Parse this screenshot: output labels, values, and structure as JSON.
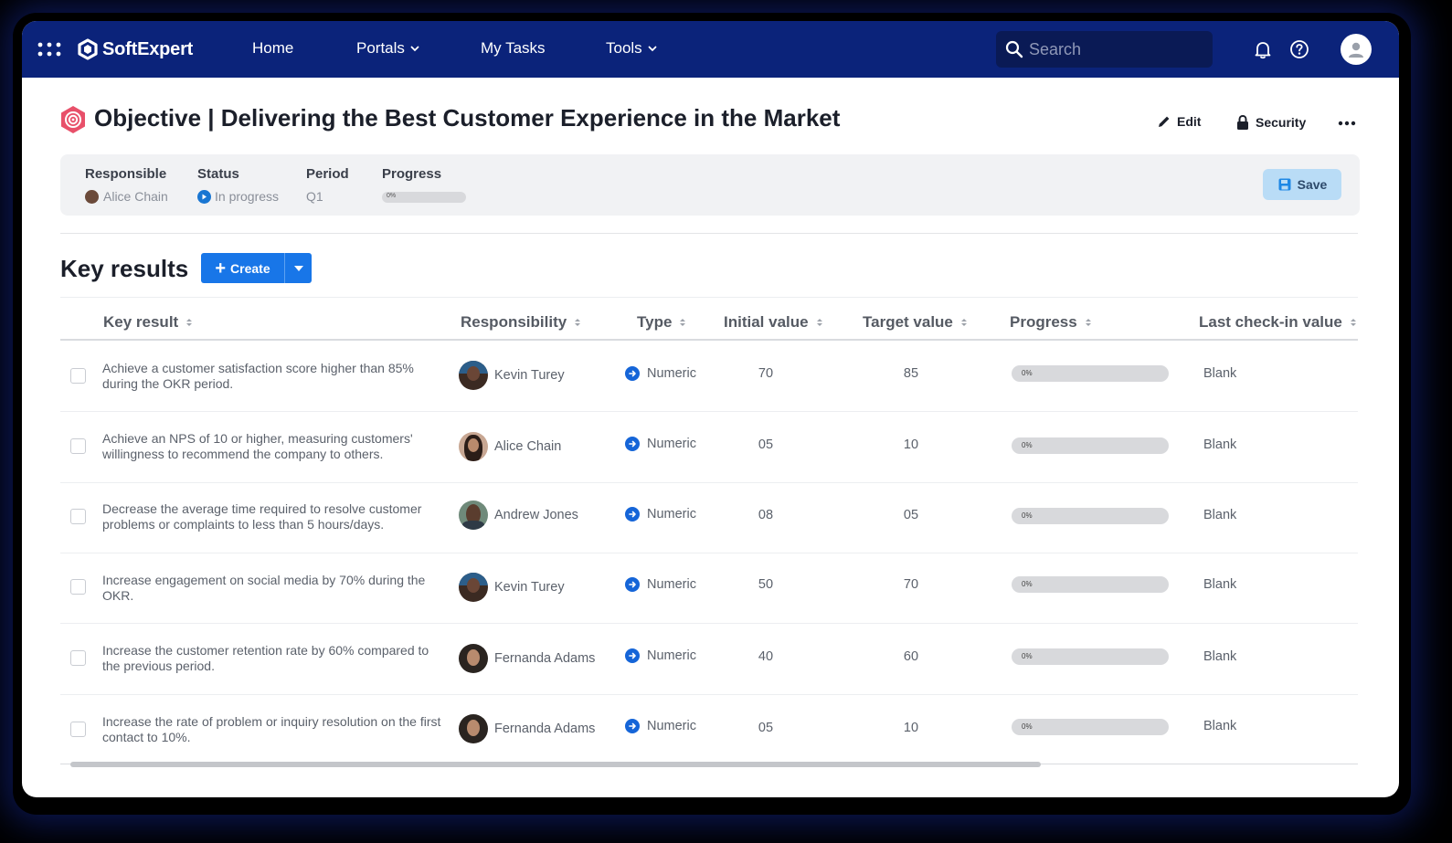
{
  "brand": {
    "name": "SoftExpert"
  },
  "nav": {
    "home": "Home",
    "portals": "Portals",
    "my_tasks": "My Tasks",
    "tools": "Tools"
  },
  "search": {
    "placeholder": "Search",
    "value": ""
  },
  "header": {
    "title": "Objective | Delivering the Best Customer Experience in the Market",
    "edit_label": "Edit",
    "security_label": "Security"
  },
  "info": {
    "responsible_label": "Responsible",
    "responsible_value": "Alice Chain",
    "status_label": "Status",
    "status_value": "In progress",
    "period_label": "Period",
    "period_value": "Q1",
    "progress_label": "Progress",
    "progress_text": "0%",
    "progress_fraction": 0,
    "save_label": "Save"
  },
  "key_results": {
    "title": "Key results",
    "create_label": "Create",
    "columns": {
      "key_result": "Key result",
      "responsibility": "Responsibility",
      "type": "Type",
      "initial_value": "Initial value",
      "target_value": "Target value",
      "progress": "Progress",
      "last_checkin": "Last check-in value"
    },
    "rows": [
      {
        "text": "Achieve a customer satisfaction score higher than 85% during the OKR period.",
        "responsible": "Kevin Turey",
        "type": "Numeric",
        "initial": "70",
        "target": "85",
        "progress_text": "0%",
        "progress_fraction": 0,
        "last_checkin": "Blank"
      },
      {
        "text": "Achieve an NPS of 10 or higher, measuring customers' willingness to recommend the company to others.",
        "responsible": "Alice Chain",
        "type": "Numeric",
        "initial": "05",
        "target": "10",
        "progress_text": "0%",
        "progress_fraction": 0,
        "last_checkin": "Blank"
      },
      {
        "text": "Decrease the average time required to resolve customer problems or complaints to less than 5 hours/days.",
        "responsible": "Andrew Jones",
        "type": "Numeric",
        "initial": "08",
        "target": "05",
        "progress_text": "0%",
        "progress_fraction": 0,
        "last_checkin": "Blank"
      },
      {
        "text": "Increase engagement on social media by 70% during the OKR.",
        "responsible": "Kevin Turey",
        "type": "Numeric",
        "initial": "50",
        "target": "70",
        "progress_text": "0%",
        "progress_fraction": 0,
        "last_checkin": "Blank"
      },
      {
        "text": "Increase the customer retention rate by 60% compared to the previous period.",
        "responsible": "Fernanda Adams",
        "type": "Numeric",
        "initial": "40",
        "target": "60",
        "progress_text": "0%",
        "progress_fraction": 0,
        "last_checkin": "Blank"
      },
      {
        "text": "Increase the rate of problem or inquiry resolution on the first contact to 10%.",
        "responsible": "Fernanda Adams",
        "type": "Numeric",
        "initial": "05",
        "target": "10",
        "progress_text": "0%",
        "progress_fraction": 0,
        "last_checkin": "Blank"
      }
    ]
  },
  "colors": {
    "topbar": "#0b237a",
    "accent": "#1876e8",
    "save_bg": "#b9dcf6",
    "objective_icon": "#e8506a"
  },
  "icons": [
    "apps-grid-icon",
    "softexpert-logo-icon",
    "chevron-down-icon",
    "search-icon",
    "bell-icon",
    "help-icon",
    "user-icon",
    "target-icon",
    "pencil-icon",
    "lock-icon",
    "more-horizontal-icon",
    "save-icon",
    "plus-icon",
    "caret-down-icon",
    "sort-icon",
    "arrow-right-circle-icon"
  ]
}
